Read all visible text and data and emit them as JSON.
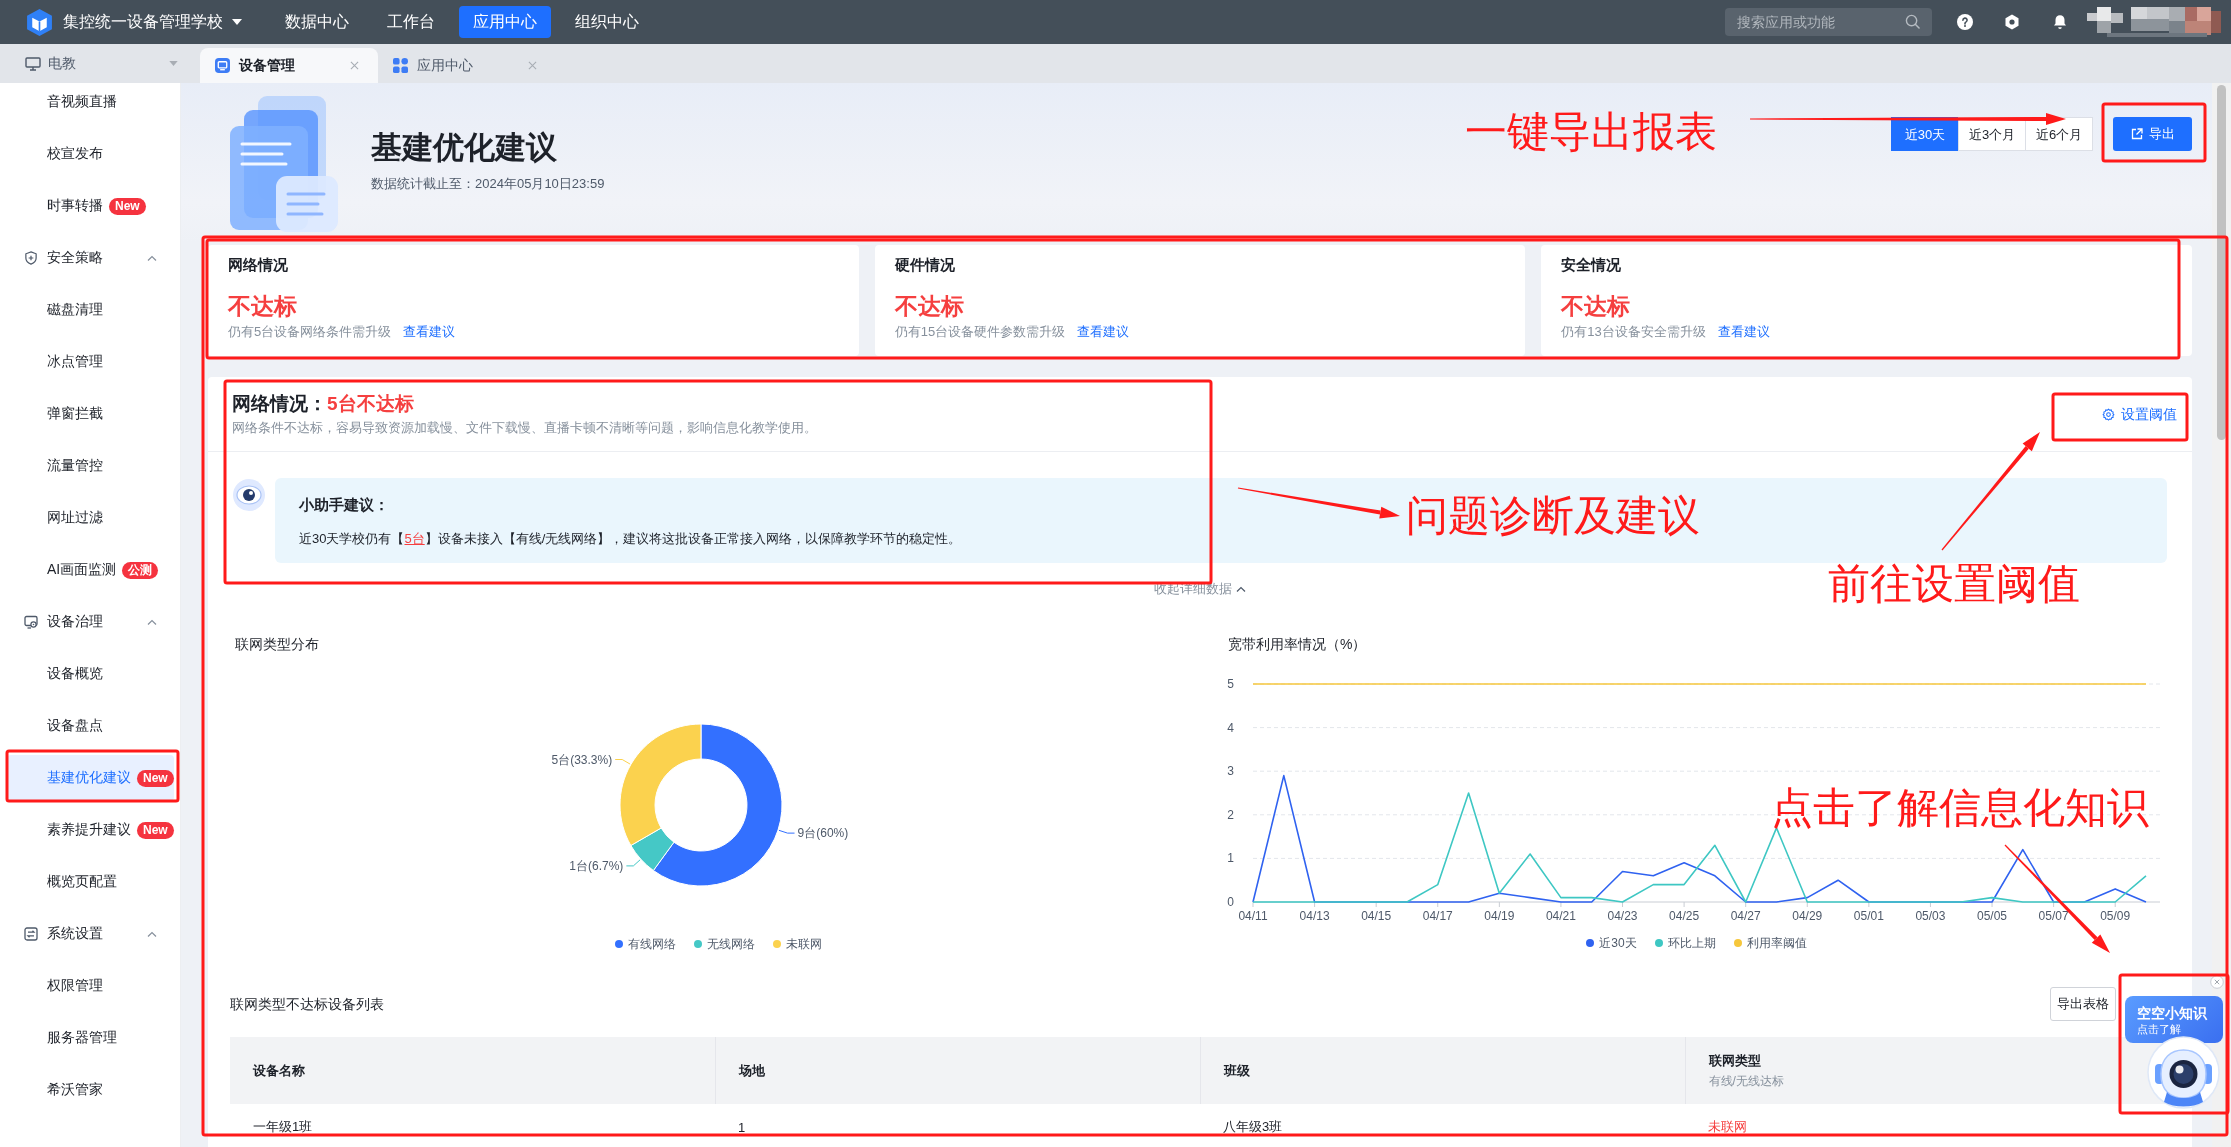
{
  "top_bar": {
    "school": "集控统一设备管理学校",
    "nav": [
      {
        "label": "数据中心",
        "selected": false
      },
      {
        "label": "工作台",
        "selected": false
      },
      {
        "label": "应用中心",
        "selected": true
      },
      {
        "label": "组织中心",
        "selected": false
      }
    ],
    "search": {
      "placeholder": "搜索应用或功能"
    }
  },
  "workspace": {
    "label": "电教"
  },
  "tabs": [
    {
      "label": "设备管理",
      "selected": true
    },
    {
      "label": "应用中心",
      "selected": false
    }
  ],
  "sidebar": {
    "items": [
      {
        "kind": "item",
        "label": "音视频直播",
        "selected": false
      },
      {
        "kind": "item",
        "label": "校宣发布",
        "selected": false
      },
      {
        "kind": "item",
        "label": "时事转播",
        "selected": false,
        "badge": "New"
      },
      {
        "kind": "group",
        "label": "安全策略",
        "selected": false,
        "expanded": true,
        "children": [
          {
            "label": "磁盘清理",
            "selected": false
          },
          {
            "label": "冰点管理",
            "selected": false
          },
          {
            "label": "弹窗拦截",
            "selected": false
          },
          {
            "label": "流量管控",
            "selected": false
          },
          {
            "label": "网址过滤",
            "selected": false
          },
          {
            "label": "AI画面监测",
            "selected": false,
            "badge": "公测"
          }
        ]
      },
      {
        "kind": "group",
        "label": "设备治理",
        "selected": false,
        "expanded": true,
        "children": [
          {
            "label": "设备概览",
            "selected": false
          },
          {
            "label": "设备盘点",
            "selected": false
          },
          {
            "label": "基建优化建议",
            "selected": true,
            "badge": "New"
          },
          {
            "label": "素养提升建议",
            "selected": false,
            "badge": "New"
          },
          {
            "label": "概览页配置",
            "selected": false
          }
        ]
      },
      {
        "kind": "group",
        "label": "系统设置",
        "selected": false,
        "expanded": true,
        "children": [
          {
            "label": "权限管理",
            "selected": false
          },
          {
            "label": "服务器管理",
            "selected": false
          },
          {
            "label": "希沃管家",
            "selected": false
          }
        ]
      }
    ]
  },
  "header": {
    "title": "基建优化建议",
    "subtitle": "数据统计截止至：2024年05月10日23:59",
    "ranges": [
      {
        "label": "近30天",
        "selected": true
      },
      {
        "label": "近3个月",
        "selected": false
      },
      {
        "label": "近6个月",
        "selected": false
      }
    ],
    "export_button": "导出"
  },
  "cards": [
    {
      "title": "网络情况",
      "status": "不达标",
      "description": "仍有5台设备网络条件需升级",
      "link": "查看建议"
    },
    {
      "title": "硬件情况",
      "status": "不达标",
      "description": "仍有15台设备硬件参数需升级",
      "link": "查看建议"
    },
    {
      "title": "安全情况",
      "status": "不达标",
      "description": "仍有13台设备安全需升级",
      "link": "查看建议"
    }
  ],
  "section": {
    "title": "网络情况：",
    "status": "5台不达标",
    "description": "网络条件不达标，容易导致资源加载慢、文件下载慢、直播卡顿不清晰等问题，影响信息化教学使用。",
    "settings_link": "设置阈值",
    "assistant": {
      "title": "小助手建议：",
      "text_before": "近30天学校仍有【",
      "highlight": "5台",
      "text_after": "】设备未接入【有线/无线网络】，建议将这批设备正常接入网络，以保障教学环节的稳定性。"
    },
    "collapse_toggle": {
      "label": "收起详细数据",
      "expanded": true
    }
  },
  "distribution": {
    "title": "联网类型分布",
    "chart_data": {
      "type": "donut",
      "values": [
        9,
        1,
        5
      ],
      "value_labels": [
        "9台(60%)",
        "1台(6.7%)",
        "5台(33.3%)"
      ]
    },
    "legend": [
      {
        "label": "有线网络",
        "color": "#3370ff"
      },
      {
        "label": "无线网络",
        "color": "#45c8c6"
      },
      {
        "label": "未联网",
        "color": "#fbd24e"
      }
    ]
  },
  "bandwidth": {
    "title": "宽带利用率情况（%）",
    "chart_data": {
      "type": "line",
      "categories": [
        "04/11",
        null,
        "04/13",
        null,
        "04/15",
        null,
        "04/17",
        null,
        "04/19",
        null,
        "04/21",
        null,
        "04/23",
        null,
        "04/25",
        null,
        "04/27",
        null,
        "04/29",
        null,
        "05/01",
        null,
        "05/03",
        null,
        "05/05",
        null,
        "05/07",
        null,
        "05/09",
        null
      ],
      "ylim": [
        0,
        5
      ],
      "yticks": [
        0,
        1,
        2,
        3,
        4,
        5
      ],
      "grid": true,
      "series": [
        {
          "name": "近30天",
          "color": "#2f62f0",
          "values": [
            0,
            2.9,
            0,
            0,
            0,
            0,
            0,
            0,
            0.2,
            0.1,
            0,
            0,
            0.7,
            0.6,
            0.9,
            0.6,
            0,
            0,
            0.1,
            0.5,
            0,
            0,
            0,
            0,
            0,
            1.2,
            0,
            0,
            0.3,
            0
          ]
        },
        {
          "name": "环比上期",
          "color": "#3ec7c3",
          "values": [
            0,
            0,
            0,
            0,
            0,
            0,
            0.4,
            2.5,
            0.2,
            1.1,
            0.1,
            0.1,
            0,
            0.4,
            0.4,
            1.3,
            0,
            1.7,
            0,
            0,
            0,
            0,
            0,
            0,
            0.1,
            0,
            0,
            0,
            0,
            0.6
          ]
        },
        {
          "name": "利用率阈值",
          "color": "#f6c73c",
          "values": [
            5,
            5,
            5,
            5,
            5,
            5,
            5,
            5,
            5,
            5,
            5,
            5,
            5,
            5,
            5,
            5,
            5,
            5,
            5,
            5,
            5,
            5,
            5,
            5,
            5,
            5,
            5,
            5,
            5,
            5
          ]
        }
      ]
    }
  },
  "table": {
    "title": "联网类型不达标设备列表",
    "export_button": "导出表格",
    "columns": [
      {
        "label": "设备名称"
      },
      {
        "label": "场地"
      },
      {
        "label": "班级"
      },
      {
        "label": "联网类型",
        "sublabel": "有线/无线达标"
      }
    ],
    "rows": [
      {
        "cells": [
          "一年级1班",
          "1",
          "八年级3班",
          "未联网"
        ],
        "compliant": false
      }
    ]
  },
  "knowledge_widget": {
    "title": "空空小知识",
    "subtitle": "点击了解"
  },
  "annotations": [
    "一键导出报表",
    "问题诊断及建议",
    "前往设置阈值",
    "点击了解信息化知识"
  ]
}
